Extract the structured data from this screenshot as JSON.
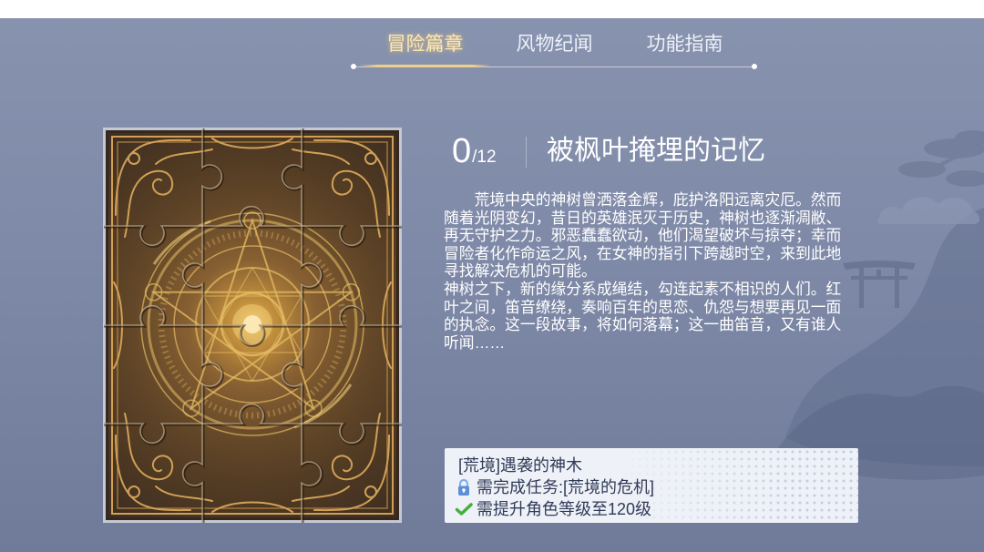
{
  "tabs": [
    {
      "label": "冒险篇章",
      "active": true
    },
    {
      "label": "风物纪闻",
      "active": false
    },
    {
      "label": "功能指南",
      "active": false
    }
  ],
  "chapter": {
    "progress": {
      "collected": "0",
      "total_label": "/12"
    },
    "title": "被枫叶掩埋的记忆",
    "description": [
      "荒境中央的神树曾洒落金辉，庇护洛阳远离灾厄。然而随着光阴变幻，昔日的英雄泯灭于历史，神树也逐渐凋敝、再无守护之力。邪恶蠢蠢欲动，他们渴望破坏与掠夺；幸而冒险者化作命运之风，在女神的指引下跨越时空，来到此地寻找解决危机的可能。",
      "神树之下，新的缘分系成绳结，勾连起素不相识的人们。红叶之间，笛音缭绕，奏响百年的思恋、仇怨与想要再见一面的执念。这一段故事，将如何落幕；这一曲笛音，又有谁人听闻……"
    ]
  },
  "unlock_panel": {
    "title": "[荒境]遇袭的神木",
    "requirements": [
      {
        "icon": "lock-icon",
        "text": "需完成任务:[荒境的危机]",
        "met": false
      },
      {
        "icon": "check-icon",
        "text": "需提升角色等级至120级",
        "met": true
      }
    ]
  },
  "colors": {
    "background_top": "#8893af",
    "background_bottom": "#6f7b99",
    "tab_active": "#fbe8b4",
    "tab_inactive": "#eef1f8",
    "tab_underline": "#efd088",
    "panel_bg": "#eef1f7",
    "panel_text": "#303b57",
    "lock_blue": "#5b8fd8",
    "check_green": "#45b03a",
    "card_gold": "#cf9d50"
  }
}
